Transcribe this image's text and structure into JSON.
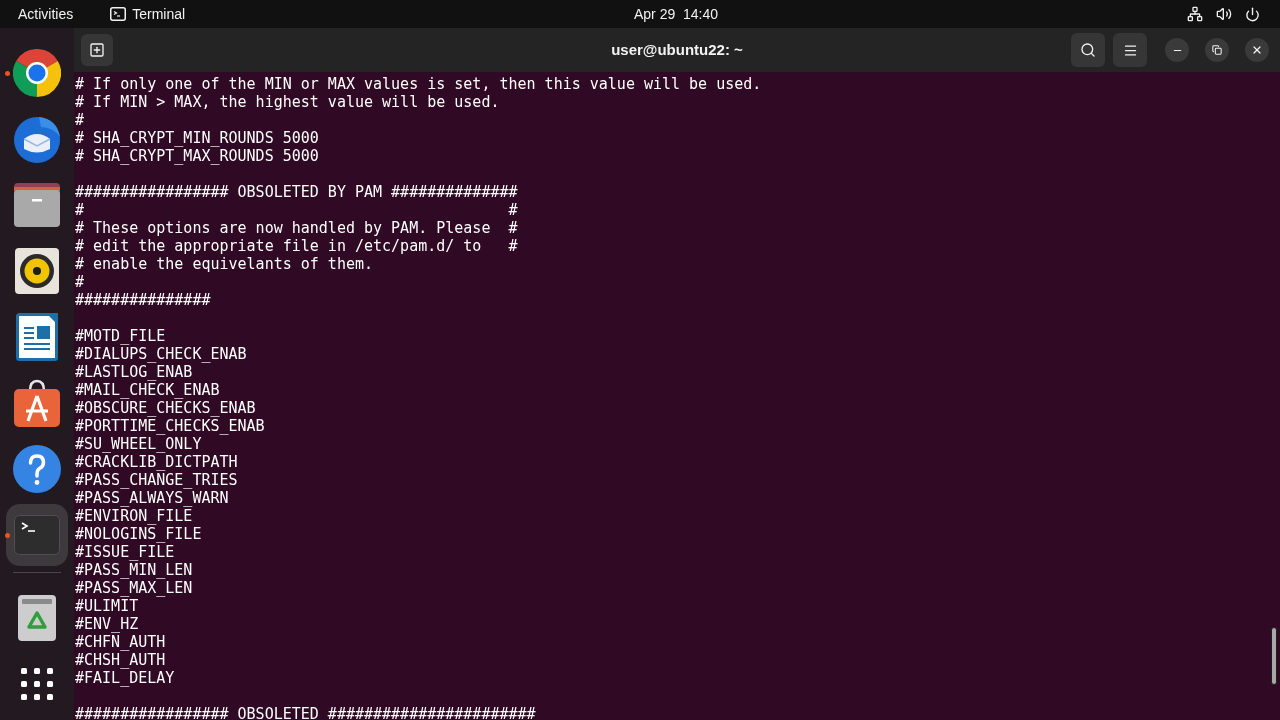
{
  "top_bar": {
    "activities": "Activities",
    "app_menu": "Terminal",
    "clock": "Apr 29  14:40"
  },
  "dock": {
    "apps": [
      {
        "kind": "browser",
        "running": true,
        "selected": false
      },
      {
        "kind": "mail",
        "running": false,
        "selected": false
      },
      {
        "kind": "files",
        "running": false,
        "selected": false
      },
      {
        "kind": "music",
        "running": false,
        "selected": false
      },
      {
        "kind": "writer",
        "running": false,
        "selected": false
      },
      {
        "kind": "store",
        "running": false,
        "selected": false
      },
      {
        "kind": "help",
        "running": false,
        "selected": false
      },
      {
        "kind": "terminal",
        "running": true,
        "selected": true
      }
    ],
    "bottom": [
      {
        "kind": "trash"
      },
      {
        "kind": "grid"
      }
    ]
  },
  "window": {
    "title": "user@ubuntu22: ~"
  },
  "terminal": {
    "blocks": [
      [
        "# If only one of the MIN or MAX values is set, then this value will be used.",
        "# If MIN > MAX, the highest value will be used.",
        "#",
        "# SHA_CRYPT_MIN_ROUNDS 5000",
        "# SHA_CRYPT_MAX_ROUNDS 5000"
      ],
      [
        "################# OBSOLETED BY PAM ##############",
        "#                                               #",
        "# These options are now handled by PAM. Please  #",
        "# edit the appropriate file in /etc/pam.d/ to   #",
        "# enable the equivelants of them.",
        "#",
        "###############"
      ],
      [
        "#MOTD_FILE",
        "#DIALUPS_CHECK_ENAB",
        "#LASTLOG_ENAB",
        "#MAIL_CHECK_ENAB",
        "#OBSCURE_CHECKS_ENAB",
        "#PORTTIME_CHECKS_ENAB",
        "#SU_WHEEL_ONLY",
        "#CRACKLIB_DICTPATH",
        "#PASS_CHANGE_TRIES",
        "#PASS_ALWAYS_WARN",
        "#ENVIRON_FILE",
        "#NOLOGINS_FILE",
        "#ISSUE_FILE",
        "#PASS_MIN_LEN",
        "#PASS_MAX_LEN",
        "#ULIMIT",
        "#ENV_HZ",
        "#CHFN_AUTH",
        "#CHSH_AUTH",
        "#FAIL_DELAY"
      ],
      [
        "################# OBSOLETED #######################"
      ]
    ]
  }
}
